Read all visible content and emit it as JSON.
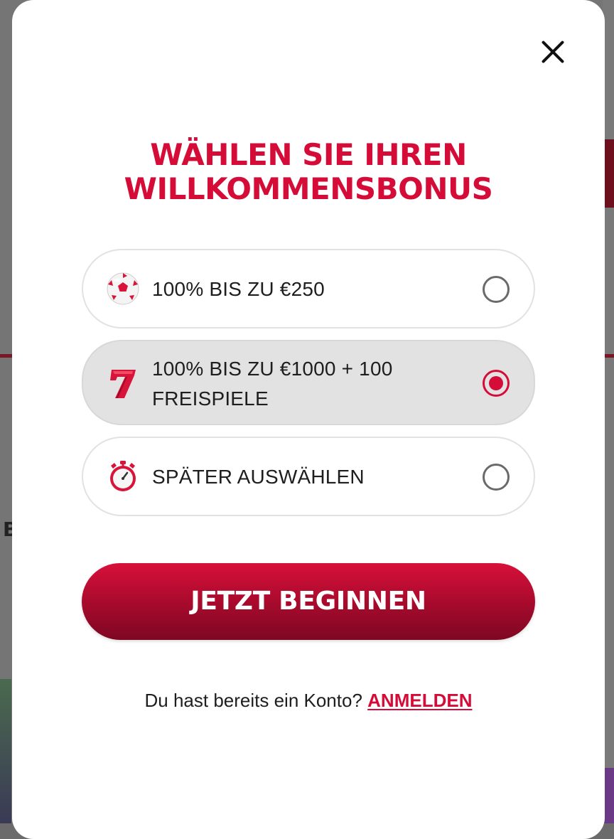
{
  "background": {
    "fragment_left": "B"
  },
  "modal": {
    "close_icon": "close-icon",
    "title_line1": "WÄHLEN SIE IHREN",
    "title_line2": "WILLKOMMENSBONUS",
    "options": [
      {
        "icon": "soccer-ball-icon",
        "label": "100% BIS ZU €250",
        "selected": false
      },
      {
        "icon": "lucky-seven-icon",
        "label_line1": "100% BIS ZU €1000 + 100",
        "label_line2": "FREISPIELE",
        "selected": true
      },
      {
        "icon": "stopwatch-icon",
        "label": "SPÄTER AUSWÄHLEN",
        "selected": false
      }
    ],
    "cta_label": "JETZT BEGINNEN",
    "login_prompt": "Du hast bereits ein Konto?",
    "login_link": "ANMELDEN"
  },
  "colors": {
    "accent": "#d50c38",
    "selected_bg": "#e2e2e2",
    "cta_dark": "#7e0722"
  }
}
